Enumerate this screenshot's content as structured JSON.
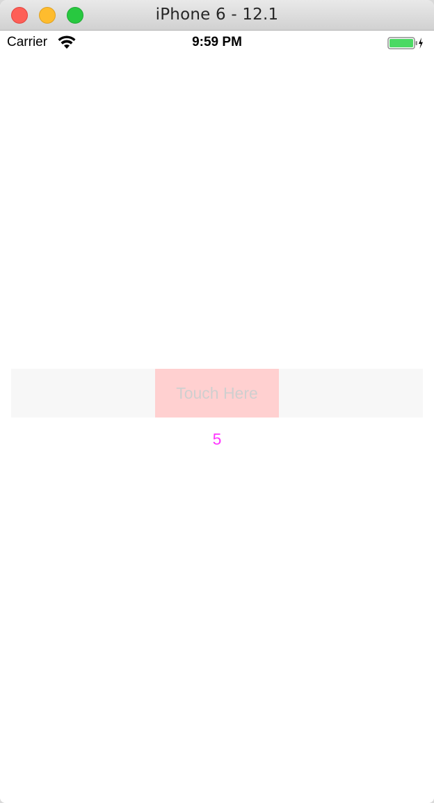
{
  "window": {
    "title": "iPhone 6 - 12.1"
  },
  "status_bar": {
    "carrier": "Carrier",
    "time": "9:59 PM",
    "icons": [
      "wifi-icon",
      "battery-icon",
      "charging-bolt-icon"
    ],
    "battery_color": "#4cd964"
  },
  "screen": {
    "button_label": "Touch Here",
    "counter_value": "5",
    "colors": {
      "button_background": "#ffd0d0",
      "button_text": "#cfcfcf",
      "bar_background": "#f7f7f7",
      "counter_text": "#ff35ff"
    }
  }
}
